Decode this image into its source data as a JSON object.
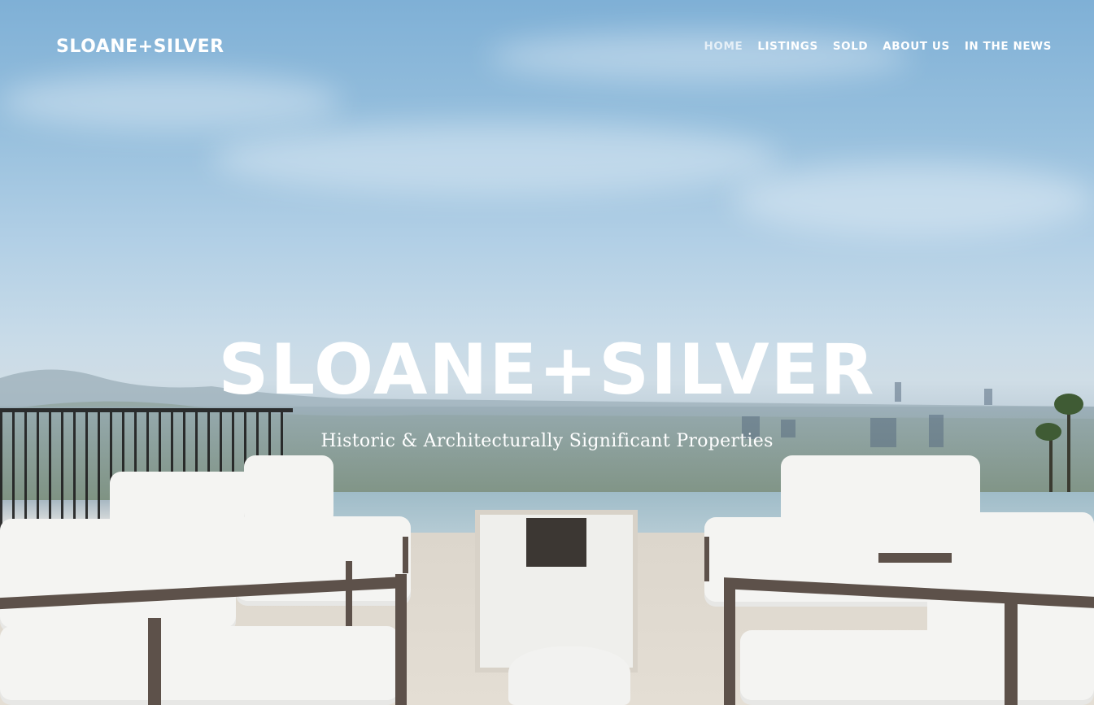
{
  "header": {
    "logo": "SLOANE+SILVER",
    "nav": [
      {
        "label": "HOME",
        "active": true
      },
      {
        "label": "LISTINGS",
        "active": false
      },
      {
        "label": "SOLD",
        "active": false
      },
      {
        "label": "ABOUT US",
        "active": false
      },
      {
        "label": "IN THE NEWS",
        "active": false
      }
    ]
  },
  "hero": {
    "title": "SLOANE+SILVER",
    "subtitle": "Historic & Architecturally Significant Properties"
  },
  "colors": {
    "text": "#ffffff",
    "nav_active": "#ffffffb3",
    "sky": "#7fb0d6"
  }
}
